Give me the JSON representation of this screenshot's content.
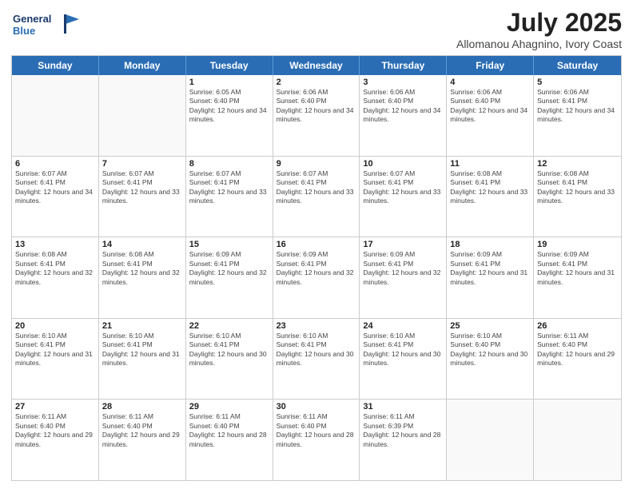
{
  "header": {
    "logo_line1": "General",
    "logo_line2": "Blue",
    "month_title": "July 2025",
    "location": "Allomanou Ahagnino, Ivory Coast"
  },
  "day_headers": [
    "Sunday",
    "Monday",
    "Tuesday",
    "Wednesday",
    "Thursday",
    "Friday",
    "Saturday"
  ],
  "weeks": [
    [
      {
        "day": "",
        "info": ""
      },
      {
        "day": "",
        "info": ""
      },
      {
        "day": "1",
        "info": "Sunrise: 6:05 AM\nSunset: 6:40 PM\nDaylight: 12 hours and 34 minutes."
      },
      {
        "day": "2",
        "info": "Sunrise: 6:06 AM\nSunset: 6:40 PM\nDaylight: 12 hours and 34 minutes."
      },
      {
        "day": "3",
        "info": "Sunrise: 6:06 AM\nSunset: 6:40 PM\nDaylight: 12 hours and 34 minutes."
      },
      {
        "day": "4",
        "info": "Sunrise: 6:06 AM\nSunset: 6:40 PM\nDaylight: 12 hours and 34 minutes."
      },
      {
        "day": "5",
        "info": "Sunrise: 6:06 AM\nSunset: 6:41 PM\nDaylight: 12 hours and 34 minutes."
      }
    ],
    [
      {
        "day": "6",
        "info": "Sunrise: 6:07 AM\nSunset: 6:41 PM\nDaylight: 12 hours and 34 minutes."
      },
      {
        "day": "7",
        "info": "Sunrise: 6:07 AM\nSunset: 6:41 PM\nDaylight: 12 hours and 33 minutes."
      },
      {
        "day": "8",
        "info": "Sunrise: 6:07 AM\nSunset: 6:41 PM\nDaylight: 12 hours and 33 minutes."
      },
      {
        "day": "9",
        "info": "Sunrise: 6:07 AM\nSunset: 6:41 PM\nDaylight: 12 hours and 33 minutes."
      },
      {
        "day": "10",
        "info": "Sunrise: 6:07 AM\nSunset: 6:41 PM\nDaylight: 12 hours and 33 minutes."
      },
      {
        "day": "11",
        "info": "Sunrise: 6:08 AM\nSunset: 6:41 PM\nDaylight: 12 hours and 33 minutes."
      },
      {
        "day": "12",
        "info": "Sunrise: 6:08 AM\nSunset: 6:41 PM\nDaylight: 12 hours and 33 minutes."
      }
    ],
    [
      {
        "day": "13",
        "info": "Sunrise: 6:08 AM\nSunset: 6:41 PM\nDaylight: 12 hours and 32 minutes."
      },
      {
        "day": "14",
        "info": "Sunrise: 6:08 AM\nSunset: 6:41 PM\nDaylight: 12 hours and 32 minutes."
      },
      {
        "day": "15",
        "info": "Sunrise: 6:09 AM\nSunset: 6:41 PM\nDaylight: 12 hours and 32 minutes."
      },
      {
        "day": "16",
        "info": "Sunrise: 6:09 AM\nSunset: 6:41 PM\nDaylight: 12 hours and 32 minutes."
      },
      {
        "day": "17",
        "info": "Sunrise: 6:09 AM\nSunset: 6:41 PM\nDaylight: 12 hours and 32 minutes."
      },
      {
        "day": "18",
        "info": "Sunrise: 6:09 AM\nSunset: 6:41 PM\nDaylight: 12 hours and 31 minutes."
      },
      {
        "day": "19",
        "info": "Sunrise: 6:09 AM\nSunset: 6:41 PM\nDaylight: 12 hours and 31 minutes."
      }
    ],
    [
      {
        "day": "20",
        "info": "Sunrise: 6:10 AM\nSunset: 6:41 PM\nDaylight: 12 hours and 31 minutes."
      },
      {
        "day": "21",
        "info": "Sunrise: 6:10 AM\nSunset: 6:41 PM\nDaylight: 12 hours and 31 minutes."
      },
      {
        "day": "22",
        "info": "Sunrise: 6:10 AM\nSunset: 6:41 PM\nDaylight: 12 hours and 30 minutes."
      },
      {
        "day": "23",
        "info": "Sunrise: 6:10 AM\nSunset: 6:41 PM\nDaylight: 12 hours and 30 minutes."
      },
      {
        "day": "24",
        "info": "Sunrise: 6:10 AM\nSunset: 6:41 PM\nDaylight: 12 hours and 30 minutes."
      },
      {
        "day": "25",
        "info": "Sunrise: 6:10 AM\nSunset: 6:40 PM\nDaylight: 12 hours and 30 minutes."
      },
      {
        "day": "26",
        "info": "Sunrise: 6:11 AM\nSunset: 6:40 PM\nDaylight: 12 hours and 29 minutes."
      }
    ],
    [
      {
        "day": "27",
        "info": "Sunrise: 6:11 AM\nSunset: 6:40 PM\nDaylight: 12 hours and 29 minutes."
      },
      {
        "day": "28",
        "info": "Sunrise: 6:11 AM\nSunset: 6:40 PM\nDaylight: 12 hours and 29 minutes."
      },
      {
        "day": "29",
        "info": "Sunrise: 6:11 AM\nSunset: 6:40 PM\nDaylight: 12 hours and 28 minutes."
      },
      {
        "day": "30",
        "info": "Sunrise: 6:11 AM\nSunset: 6:40 PM\nDaylight: 12 hours and 28 minutes."
      },
      {
        "day": "31",
        "info": "Sunrise: 6:11 AM\nSunset: 6:39 PM\nDaylight: 12 hours and 28 minutes."
      },
      {
        "day": "",
        "info": ""
      },
      {
        "day": "",
        "info": ""
      }
    ]
  ]
}
